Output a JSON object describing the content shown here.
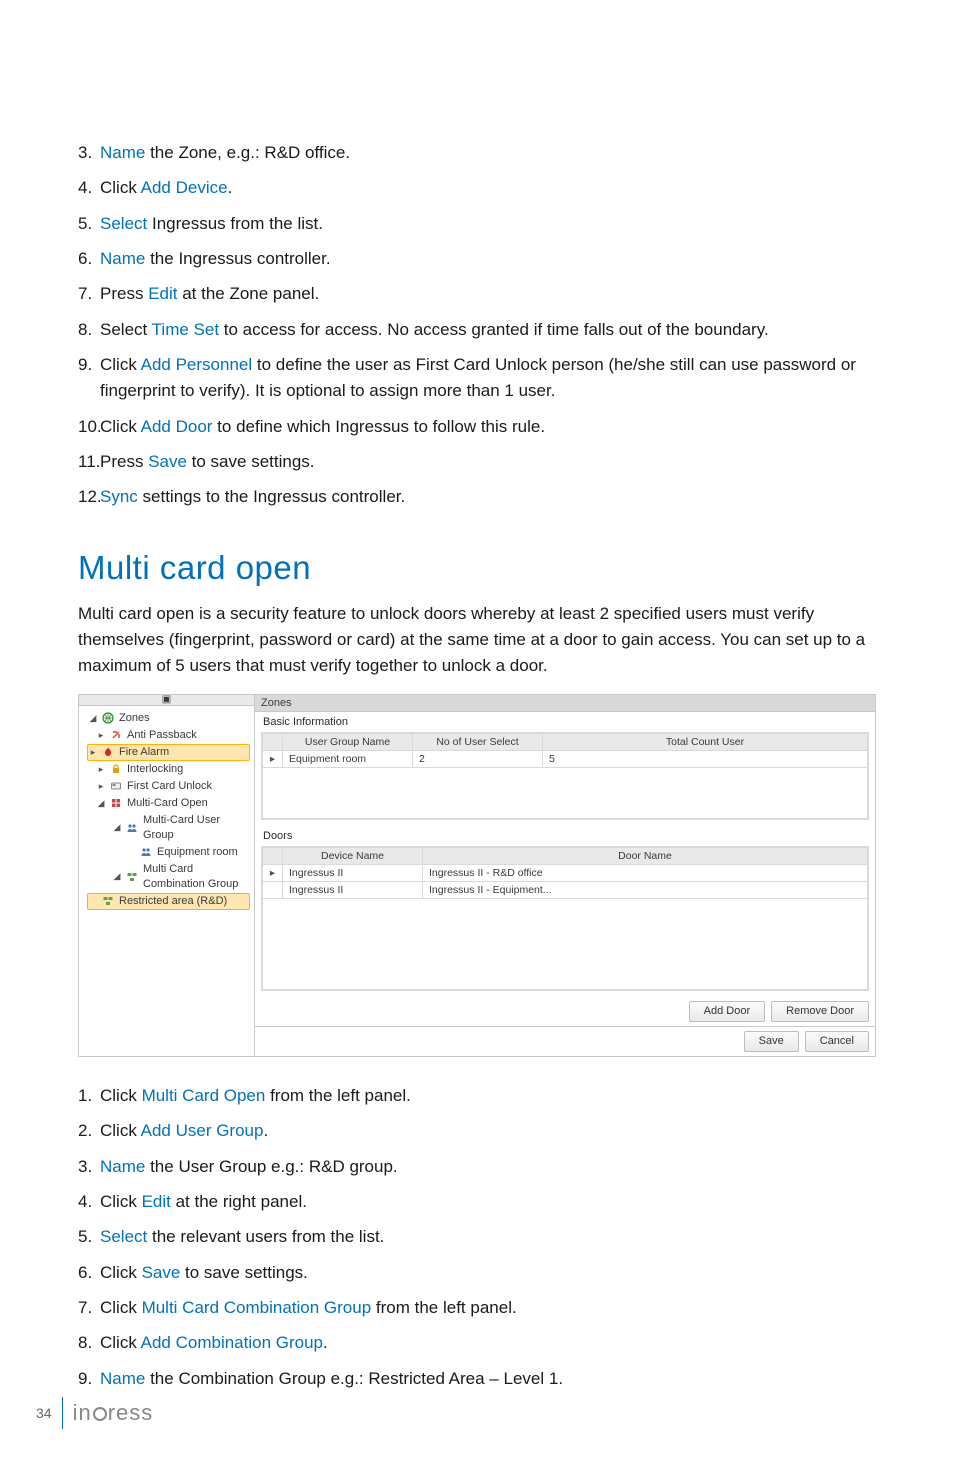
{
  "steps1": [
    {
      "n": "3.",
      "parts": [
        {
          "t": "Name",
          "link": true
        },
        {
          "t": " the Zone, e.g.: R&D office."
        }
      ]
    },
    {
      "n": "4.",
      "parts": [
        {
          "t": "Click "
        },
        {
          "t": "Add Device",
          "link": true
        },
        {
          "t": "."
        }
      ]
    },
    {
      "n": "5.",
      "parts": [
        {
          "t": "Select",
          "link": true
        },
        {
          "t": " Ingressus from the list."
        }
      ]
    },
    {
      "n": "6.",
      "parts": [
        {
          "t": "Name",
          "link": true
        },
        {
          "t": " the Ingressus controller."
        }
      ]
    },
    {
      "n": "7.",
      "parts": [
        {
          "t": "Press "
        },
        {
          "t": "Edit",
          "link": true
        },
        {
          "t": " at the Zone panel."
        }
      ]
    },
    {
      "n": "8.",
      "parts": [
        {
          "t": "Select "
        },
        {
          "t": "Time Set",
          "link": true
        },
        {
          "t": " to access for access. No access granted if time falls out of the boundary."
        }
      ]
    },
    {
      "n": "9.",
      "parts": [
        {
          "t": "Click "
        },
        {
          "t": "Add Personnel",
          "link": true
        },
        {
          "t": " to define the user as First Card Unlock person (he/she still can use password or fingerprint to verify). It is optional to assign more than 1 user."
        }
      ]
    },
    {
      "n": "10.",
      "parts": [
        {
          "t": "Click "
        },
        {
          "t": "Add Door",
          "link": true
        },
        {
          "t": " to define which Ingressus to follow this rule."
        }
      ]
    },
    {
      "n": "11.",
      "parts": [
        {
          "t": "Press "
        },
        {
          "t": "Save",
          "link": true
        },
        {
          "t": " to save settings."
        }
      ]
    },
    {
      "n": "12.",
      "parts": [
        {
          "t": "Sync",
          "link": true
        },
        {
          "t": " settings to the Ingressus controller."
        }
      ]
    }
  ],
  "heading": "Multi card open",
  "intro": "Multi card open is a security feature to unlock doors whereby at least 2 specified users must verify themselves (fingerprint, password or card) at the same time at a door to gain access. You can set up to a maximum of 5 users that must verify together to unlock a door.",
  "shot": {
    "pin": "▣",
    "tree": [
      {
        "level": 0,
        "exp": "◢",
        "icon": "globe",
        "label": "Zones"
      },
      {
        "level": 1,
        "exp": "▸",
        "icon": "anti",
        "label": "Anti Passback"
      },
      {
        "level": 1,
        "exp": "▸",
        "icon": "fire",
        "label": "Fire Alarm",
        "sel": true
      },
      {
        "level": 1,
        "exp": "▸",
        "icon": "lock",
        "label": "Interlocking"
      },
      {
        "level": 1,
        "exp": "▸",
        "icon": "card",
        "label": "First Card Unlock"
      },
      {
        "level": 1,
        "exp": "◢",
        "icon": "multi",
        "label": "Multi-Card Open"
      },
      {
        "level": 2,
        "exp": "◢",
        "icon": "group",
        "label": "Multi-Card User Group"
      },
      {
        "level": 3,
        "exp": "",
        "icon": "group",
        "label": "Equipment room"
      },
      {
        "level": 2,
        "exp": "◢",
        "icon": "combo",
        "label": "Multi Card Combination Group"
      },
      {
        "level": 3,
        "exp": "",
        "icon": "combo",
        "label": "Restricted area (R&D)",
        "sel": true
      }
    ],
    "zoneTitle": "Zones",
    "basicLabel": "Basic Information",
    "basicHeaders": [
      "",
      "User Group Name",
      "No of User Select",
      "Total Count User"
    ],
    "basicRows": [
      [
        "▸",
        "Equipment room",
        "2",
        "5"
      ]
    ],
    "doorsLabel": "Doors",
    "doorsHeaders": [
      "",
      "Device Name",
      "Door Name"
    ],
    "doorsRows": [
      [
        "▸",
        "Ingressus II",
        "Ingressus II - R&D office"
      ],
      [
        "",
        "Ingressus II",
        "Ingressus II - Equipment..."
      ]
    ],
    "buttons": {
      "addDoor": "Add Door",
      "removeDoor": "Remove Door",
      "save": "Save",
      "cancel": "Cancel"
    }
  },
  "steps2": [
    {
      "n": "1.",
      "parts": [
        {
          "t": "Click "
        },
        {
          "t": "Multi Card Open",
          "link": true
        },
        {
          "t": " from the left panel."
        }
      ]
    },
    {
      "n": "2.",
      "parts": [
        {
          "t": "Click "
        },
        {
          "t": "Add User Group",
          "link": true
        },
        {
          "t": "."
        }
      ]
    },
    {
      "n": "3.",
      "parts": [
        {
          "t": "Name",
          "link": true
        },
        {
          "t": " the User Group e.g.: R&D group."
        }
      ]
    },
    {
      "n": "4.",
      "parts": [
        {
          "t": "Click "
        },
        {
          "t": "Edit",
          "link": true
        },
        {
          "t": " at the right panel."
        }
      ]
    },
    {
      "n": "5.",
      "parts": [
        {
          "t": "Select",
          "link": true
        },
        {
          "t": " the relevant users from the list."
        }
      ]
    },
    {
      "n": "6.",
      "parts": [
        {
          "t": "Click "
        },
        {
          "t": "Save",
          "link": true
        },
        {
          "t": " to save settings."
        }
      ]
    },
    {
      "n": "7.",
      "parts": [
        {
          "t": "Click "
        },
        {
          "t": "Multi Card Combination Group",
          "link": true
        },
        {
          "t": " from the left panel."
        }
      ]
    },
    {
      "n": "8.",
      "parts": [
        {
          "t": "Click "
        },
        {
          "t": "Add Combination Group",
          "link": true
        },
        {
          "t": "."
        }
      ]
    },
    {
      "n": "9.",
      "parts": [
        {
          "t": "Name",
          "link": true
        },
        {
          "t": " the Combination Group e.g.: Restricted Area – Level 1."
        }
      ]
    }
  ],
  "footer": {
    "page": "34",
    "brand_pre": "in",
    "brand_post": "ress"
  },
  "icons": {
    "globe": "globe",
    "anti": "anti",
    "fire": "fire",
    "lock": "lock",
    "card": "card",
    "multi": "multi",
    "group": "group",
    "combo": "combo"
  }
}
